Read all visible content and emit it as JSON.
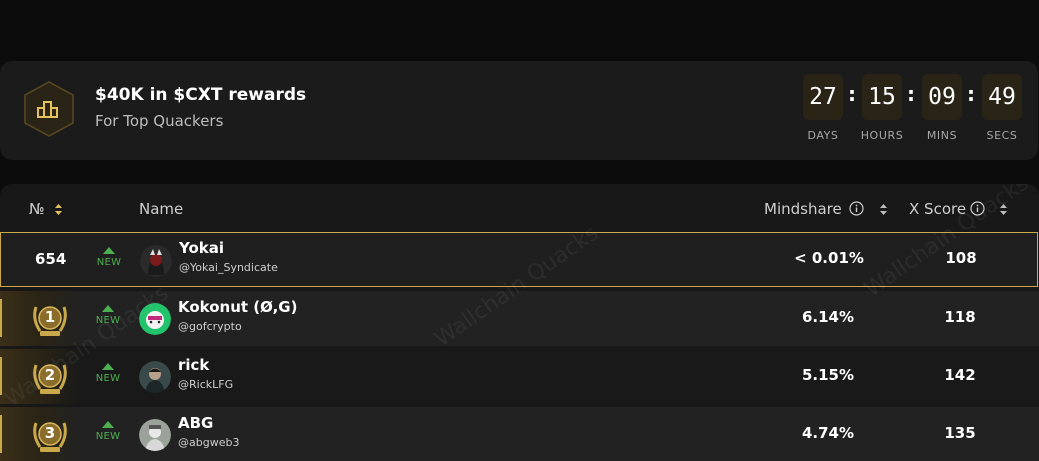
{
  "banner": {
    "title": "$40K in $CXT rewards",
    "subtitle": "For Top Quackers",
    "icon": "trophy-bar-icon"
  },
  "countdown": {
    "days": "27",
    "hours": "15",
    "mins": "09",
    "secs": "49",
    "days_label": "DAYS",
    "hours_label": "HOURS",
    "mins_label": "MINS",
    "secs_label": "SECS",
    "separator": ":"
  },
  "table": {
    "headers": {
      "rank": "№",
      "name": "Name",
      "mindshare": "Mindshare",
      "xscore": "X Score"
    },
    "watermark": "Wallchain Quacks",
    "rows": [
      {
        "rank": "654",
        "status": "NEW",
        "name": "Yokai",
        "handle": "@Yokai_Syndicate",
        "mindshare": "< 0.01%",
        "xscore": "108",
        "highlighted": true
      },
      {
        "rank": "1",
        "status": "NEW",
        "name": "Kokonut (Ø,G)",
        "handle": "@gofcrypto",
        "mindshare": "6.14%",
        "xscore": "118"
      },
      {
        "rank": "2",
        "status": "NEW",
        "name": "rick",
        "handle": "@RickLFG",
        "mindshare": "5.15%",
        "xscore": "142"
      },
      {
        "rank": "3",
        "status": "NEW",
        "name": "ABG",
        "handle": "@abgweb3",
        "mindshare": "4.74%",
        "xscore": "135"
      }
    ]
  },
  "colors": {
    "accent_gold": "#c9a94a",
    "new_green": "#4caf50",
    "background": "#0c0c0c"
  }
}
